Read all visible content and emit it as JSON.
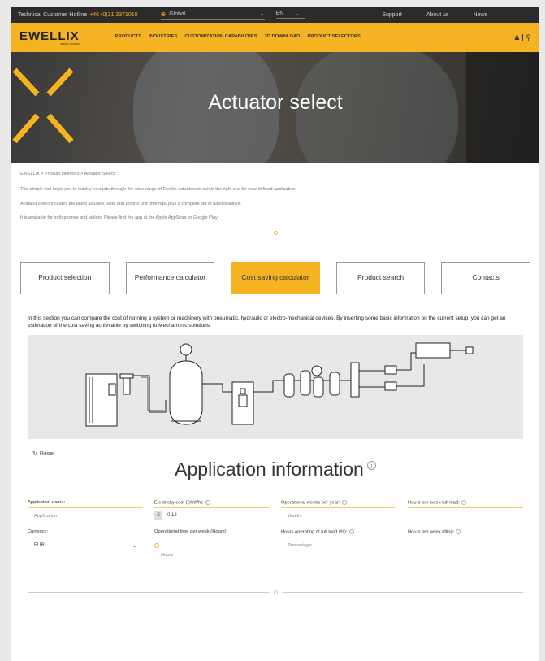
{
  "topbar": {
    "hotline_label": "Technical Customer Hotline",
    "hotline_phone": "+46 (0)31 3371010",
    "region": "Global",
    "language": "EN",
    "links": [
      "Support",
      "About us",
      "News"
    ]
  },
  "nav": {
    "logo": "EWELLIX",
    "logo_sub": "SMART MOTION",
    "menu": [
      "PRODUCTS",
      "INDUSTRIES",
      "CUSTOMIZATION CAPABILITIES",
      "3D DOWNLOAD",
      "PRODUCT SELECTORS"
    ],
    "active_menu": "PRODUCT SELECTORS"
  },
  "hero": {
    "title": "Actuator select"
  },
  "breadcrumb": "EWELLIX > Product selectors > Actuator Select",
  "intro": [
    "This simple tool helps you to quickly navigate through the wide range of Ewellix actuators to select the right one for your defined application.",
    "Actuator select includes the latest actuator, slide and control unit offerings, plus a complete set of functionalities.",
    "It is available for both phones and tablets. Please find the app at the Apple AppStore or Google Play."
  ],
  "tabs": [
    {
      "label": "Product selection"
    },
    {
      "label": "Performance calculator"
    },
    {
      "label": "Cost saving calculator"
    },
    {
      "label": "Product search"
    },
    {
      "label": "Contacts"
    }
  ],
  "active_tab": "Cost saving calculator",
  "description": "In this section you can compare the cost of running a system or machinery with pneumatic, hydraulic or electro-mechanical devices. By inserting some basic information on the current setup, you can get an estimation of the cost saving achievable by switching to Mechatronic solutions.",
  "reset_label": "Reset",
  "app_info": {
    "title": "Application information",
    "fields": {
      "application_name": {
        "label": "Application name:",
        "placeholder": "Application"
      },
      "electricity_cost": {
        "label": "Electricity cost (€/kWh):",
        "currency_symbol": "€",
        "value": "0.12"
      },
      "weeks_per_year": {
        "label": "Operational weeks per year:",
        "placeholder": "Weeks"
      },
      "hours_full_load": {
        "label": "Hours per week full load:"
      },
      "currency": {
        "label": "Currency:",
        "value": "EUR"
      },
      "time_per_week": {
        "label": "Operational time per week (Hours):",
        "unit": "Hours"
      },
      "pct_full_load": {
        "label": "Hours operating at full load (%):",
        "placeholder": "Percentage"
      },
      "hours_idling": {
        "label": "Hours per week idling:"
      }
    }
  },
  "colors": {
    "accent": "#f5b321",
    "dark": "#2b2b2b"
  }
}
